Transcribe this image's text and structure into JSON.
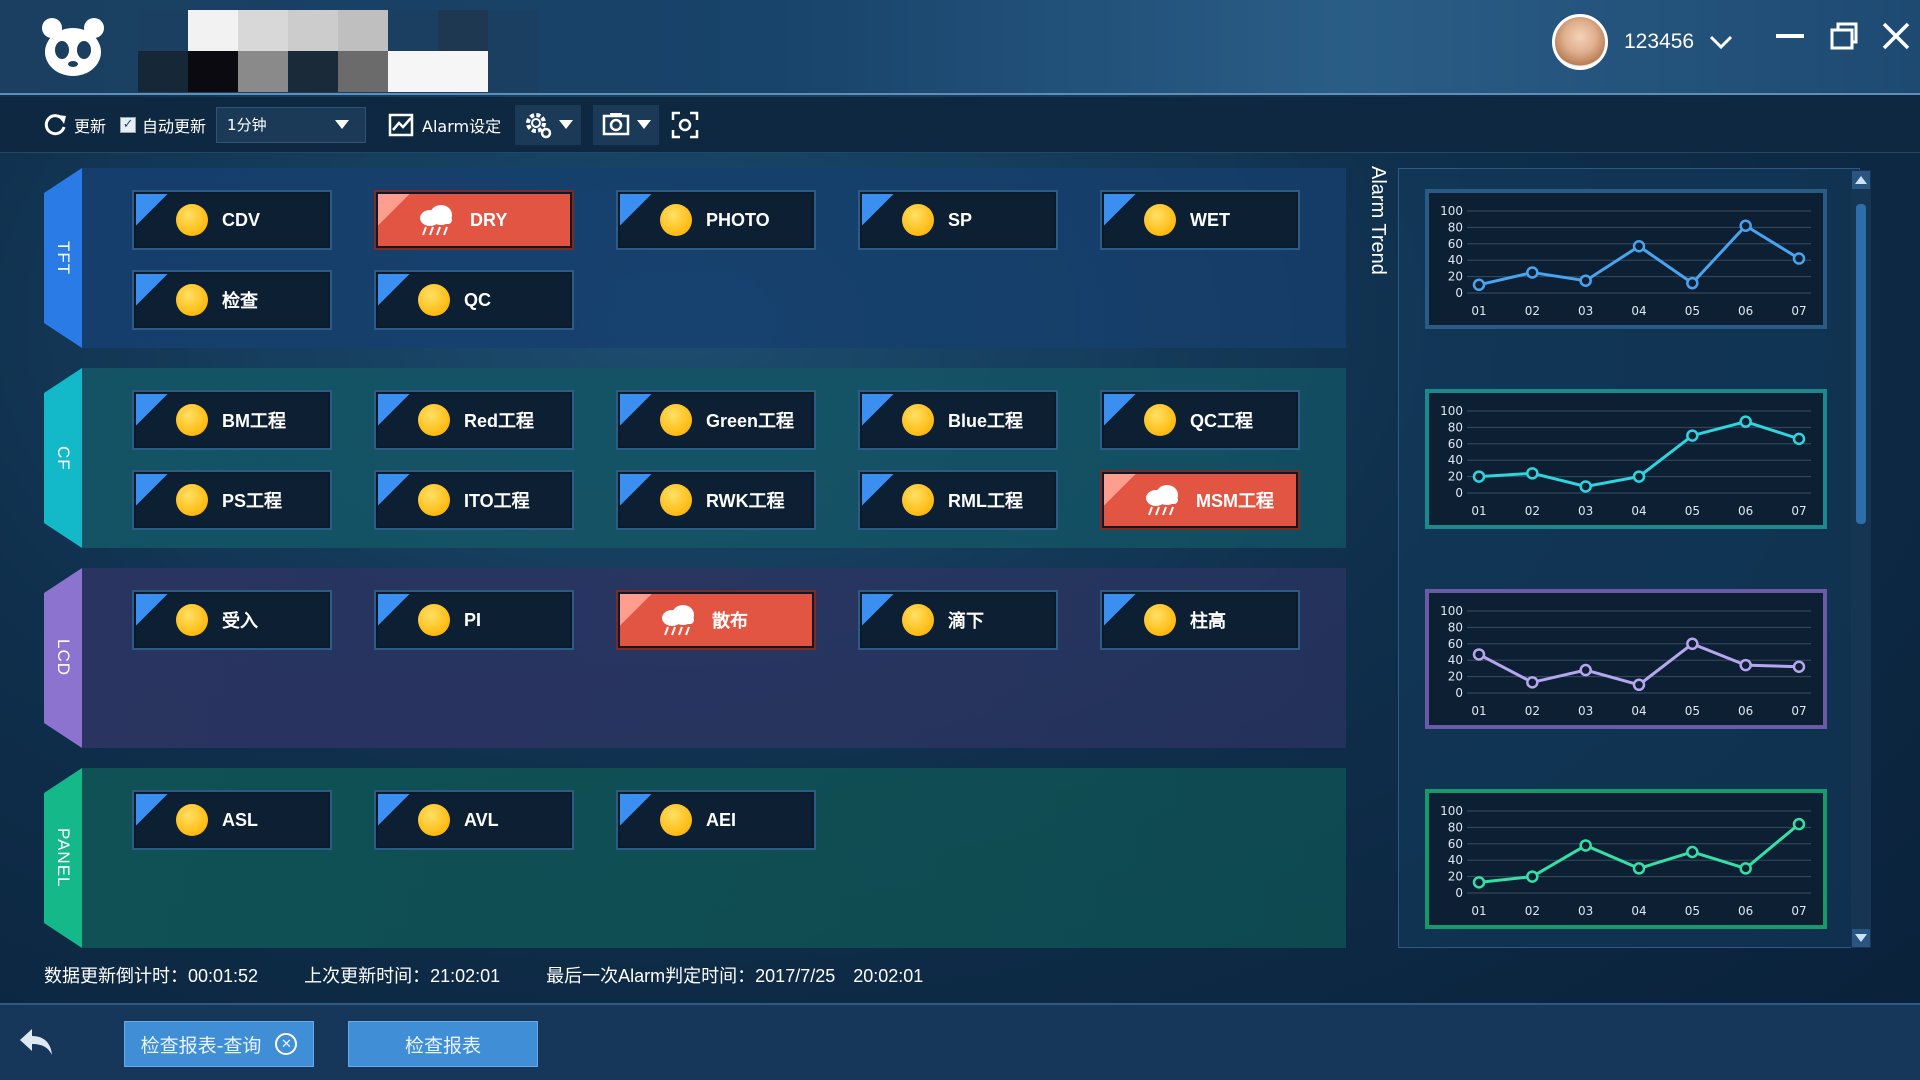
{
  "header": {
    "username": "123456",
    "mask_colors": [
      "#1a3f60",
      "#f2f2f2",
      "#d8d8d8",
      "#cccccc",
      "#bfbfbf",
      "#1a3f60",
      "#1d3850",
      "#1a3f60",
      "#162838",
      "#0a0a10",
      "#8a8a8a",
      "#1b2a38",
      "#6b6b6b",
      "#f6f6f6",
      "#f6f6f6",
      "#1a3f60"
    ]
  },
  "toolbar": {
    "refresh_label": "更新",
    "auto_refresh_label": "自动更新",
    "interval_value": "1分钟",
    "alarm_settings_label": "Alarm设定"
  },
  "sections": [
    {
      "name": "TFT",
      "color": "#2b7be6",
      "bg": "#163f6e",
      "cards": [
        {
          "label": "CDV",
          "status": "normal"
        },
        {
          "label": "DRY",
          "status": "alarm"
        },
        {
          "label": "PHOTO",
          "status": "normal"
        },
        {
          "label": "SP",
          "status": "normal"
        },
        {
          "label": "WET",
          "status": "normal"
        },
        {
          "label": "检查",
          "status": "normal"
        },
        {
          "label": "QC",
          "status": "normal"
        }
      ]
    },
    {
      "name": "CF",
      "color": "#13b9c9",
      "bg": "#135565",
      "cards": [
        {
          "label": "BM工程",
          "status": "normal"
        },
        {
          "label": "Red工程",
          "status": "normal"
        },
        {
          "label": "Green工程",
          "status": "normal"
        },
        {
          "label": "Blue工程",
          "status": "normal"
        },
        {
          "label": "QC工程",
          "status": "normal"
        },
        {
          "label": "PS工程",
          "status": "normal"
        },
        {
          "label": "ITO工程",
          "status": "normal"
        },
        {
          "label": "RWK工程",
          "status": "normal"
        },
        {
          "label": "RML工程",
          "status": "normal"
        },
        {
          "label": "MSM工程",
          "status": "alarm"
        }
      ]
    },
    {
      "name": "LCD",
      "color": "#8c73cf",
      "bg": "#2b3461",
      "cards": [
        {
          "label": "受入",
          "status": "normal"
        },
        {
          "label": "PI",
          "status": "normal"
        },
        {
          "label": "散布",
          "status": "alarm"
        },
        {
          "label": "滴下",
          "status": "normal"
        },
        {
          "label": "柱高",
          "status": "normal"
        }
      ]
    },
    {
      "name": "PANEL",
      "color": "#14b889",
      "bg": "#0f5455",
      "cards": [
        {
          "label": "ASL",
          "status": "normal"
        },
        {
          "label": "AVL",
          "status": "normal"
        },
        {
          "label": "AEI",
          "status": "normal"
        }
      ]
    }
  ],
  "trend": {
    "title": "Alarm Trend",
    "chart_data": [
      {
        "type": "line",
        "x": [
          "01",
          "02",
          "03",
          "04",
          "05",
          "06",
          "07"
        ],
        "yticks": [
          "100",
          "80",
          "60",
          "40",
          "20",
          "0"
        ],
        "ylim": [
          0,
          100
        ],
        "color": "#4aa3ef",
        "border": "#2a5a86",
        "values": [
          10,
          25,
          15,
          57,
          12,
          82,
          42
        ]
      },
      {
        "type": "line",
        "x": [
          "01",
          "02",
          "03",
          "04",
          "05",
          "06",
          "07"
        ],
        "yticks": [
          "100",
          "80",
          "60",
          "40",
          "20",
          "0"
        ],
        "ylim": [
          0,
          100
        ],
        "color": "#2fd4dd",
        "border": "#1a8a8c",
        "values": [
          20,
          24,
          8,
          20,
          70,
          87,
          66
        ]
      },
      {
        "type": "line",
        "x": [
          "01",
          "02",
          "03",
          "04",
          "05",
          "06",
          "07"
        ],
        "yticks": [
          "100",
          "80",
          "60",
          "40",
          "20",
          "0"
        ],
        "ylim": [
          0,
          100
        ],
        "color": "#b6a6f0",
        "border": "#6a5aa8",
        "values": [
          47,
          13,
          28,
          10,
          60,
          34,
          32
        ]
      },
      {
        "type": "line",
        "x": [
          "01",
          "02",
          "03",
          "04",
          "05",
          "06",
          "07"
        ],
        "yticks": [
          "100",
          "80",
          "60",
          "40",
          "20",
          "0"
        ],
        "ylim": [
          0,
          100
        ],
        "color": "#35e0a6",
        "border": "#169a6c",
        "values": [
          13,
          20,
          58,
          30,
          50,
          30,
          84
        ]
      }
    ]
  },
  "status": {
    "countdown": "数据更新倒计时：00:01:52",
    "last_update": "上次更新时间：21:02:01",
    "last_alarm": "最后一次Alarm判定时间：2017/7/25　20:02:01"
  },
  "bottom": {
    "tab1_label": "检查报表-查询",
    "tab2_label": "检查报表"
  }
}
